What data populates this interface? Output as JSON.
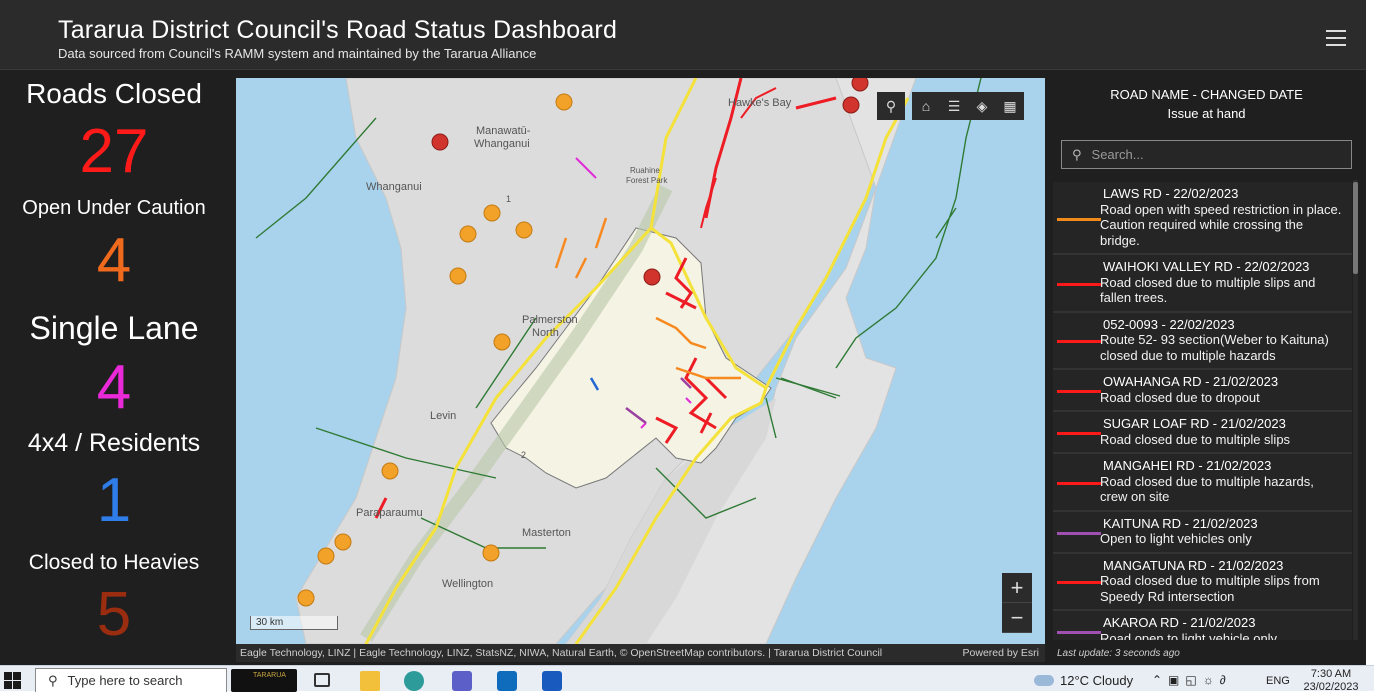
{
  "header": {
    "title": "Tararua District Council's Road Status Dashboard",
    "subtitle": "Data sourced from Council's RAMM system and maintained by the Tararua Alliance"
  },
  "stats": [
    {
      "label": "Roads Closed",
      "value": "27",
      "color": "#ff1a1a"
    },
    {
      "label": "Open Under Caution",
      "value": "4",
      "color": "#f06a1e"
    },
    {
      "label": "Single Lane",
      "value": "4",
      "color": "#ea2ad9"
    },
    {
      "label": "4x4 / Residents",
      "value": "1",
      "color": "#2f7de8"
    },
    {
      "label": "Closed to Heavies",
      "value": "5",
      "color": "#9a2c10"
    }
  ],
  "map": {
    "labels": [
      {
        "text": "Hawke's Bay"
      },
      {
        "text": "Manawatū-"
      },
      {
        "text": "Whanganui"
      },
      {
        "text": "Whanganui"
      },
      {
        "text": "Ruahine"
      },
      {
        "text": "Forest Park"
      },
      {
        "text": "Palmerston"
      },
      {
        "text": "North"
      },
      {
        "text": "Levin"
      },
      {
        "text": "Paraparaumu"
      },
      {
        "text": "Masterton"
      },
      {
        "text": "Wellington"
      },
      {
        "text": "1"
      },
      {
        "text": "2"
      }
    ],
    "scale": "30 km",
    "attribution": "Eagle Technology, LINZ | Eagle Technology, LINZ, StatsNZ, NIWA, Natural Earth, © OpenStreetMap contributors. | Tararua District Council",
    "powered_by": "Powered by Esri",
    "zoom_in": "+",
    "zoom_out": "−"
  },
  "list": {
    "header_line1": "ROAD NAME - CHANGED DATE",
    "header_line2": "Issue at hand",
    "search_placeholder": "Search...",
    "items": [
      {
        "name": "LAWS RD - 22/02/2023",
        "desc": "Road open with speed restriction in place. Caution required while crossing the bridge.",
        "color": "#f08a1a"
      },
      {
        "name": "WAIHOKI VALLEY RD - 22/02/2023",
        "desc": "Road closed due to multiple slips and fallen trees.",
        "color": "#ff1a1a"
      },
      {
        "name": "052-0093 - 22/02/2023",
        "desc": "Route 52- 93 section(Weber to Kaituna) closed due to multiple hazards",
        "color": "#ff1a1a"
      },
      {
        "name": "OWAHANGA RD - 21/02/2023",
        "desc": "Road closed due to dropout",
        "color": "#ff1a1a"
      },
      {
        "name": "SUGAR LOAF RD - 21/02/2023",
        "desc": "Road closed due to multiple slips",
        "color": "#ff1a1a"
      },
      {
        "name": "MANGAHEI RD - 21/02/2023",
        "desc": "Road closed due to multiple hazards, crew on site",
        "color": "#ff1a1a"
      },
      {
        "name": "KAITUNA RD - 21/02/2023",
        "desc": "Open to light vehicles only",
        "color": "#a050b0"
      },
      {
        "name": "MANGATUNA RD - 21/02/2023",
        "desc": "Road closed due to multiple slips from Speedy Rd intersection",
        "color": "#ff1a1a"
      },
      {
        "name": "AKAROA RD - 21/02/2023",
        "desc": "Road open to light vehicle only",
        "color": "#a050b0"
      }
    ],
    "last_update": "Last update: 3 seconds ago"
  },
  "taskbar": {
    "search_placeholder": "Type here to search",
    "pinned_label": "TARARUA",
    "weather": "12°C  Cloudy",
    "language": "ENG",
    "time": "7:30 AM",
    "date": "23/02/2023"
  }
}
